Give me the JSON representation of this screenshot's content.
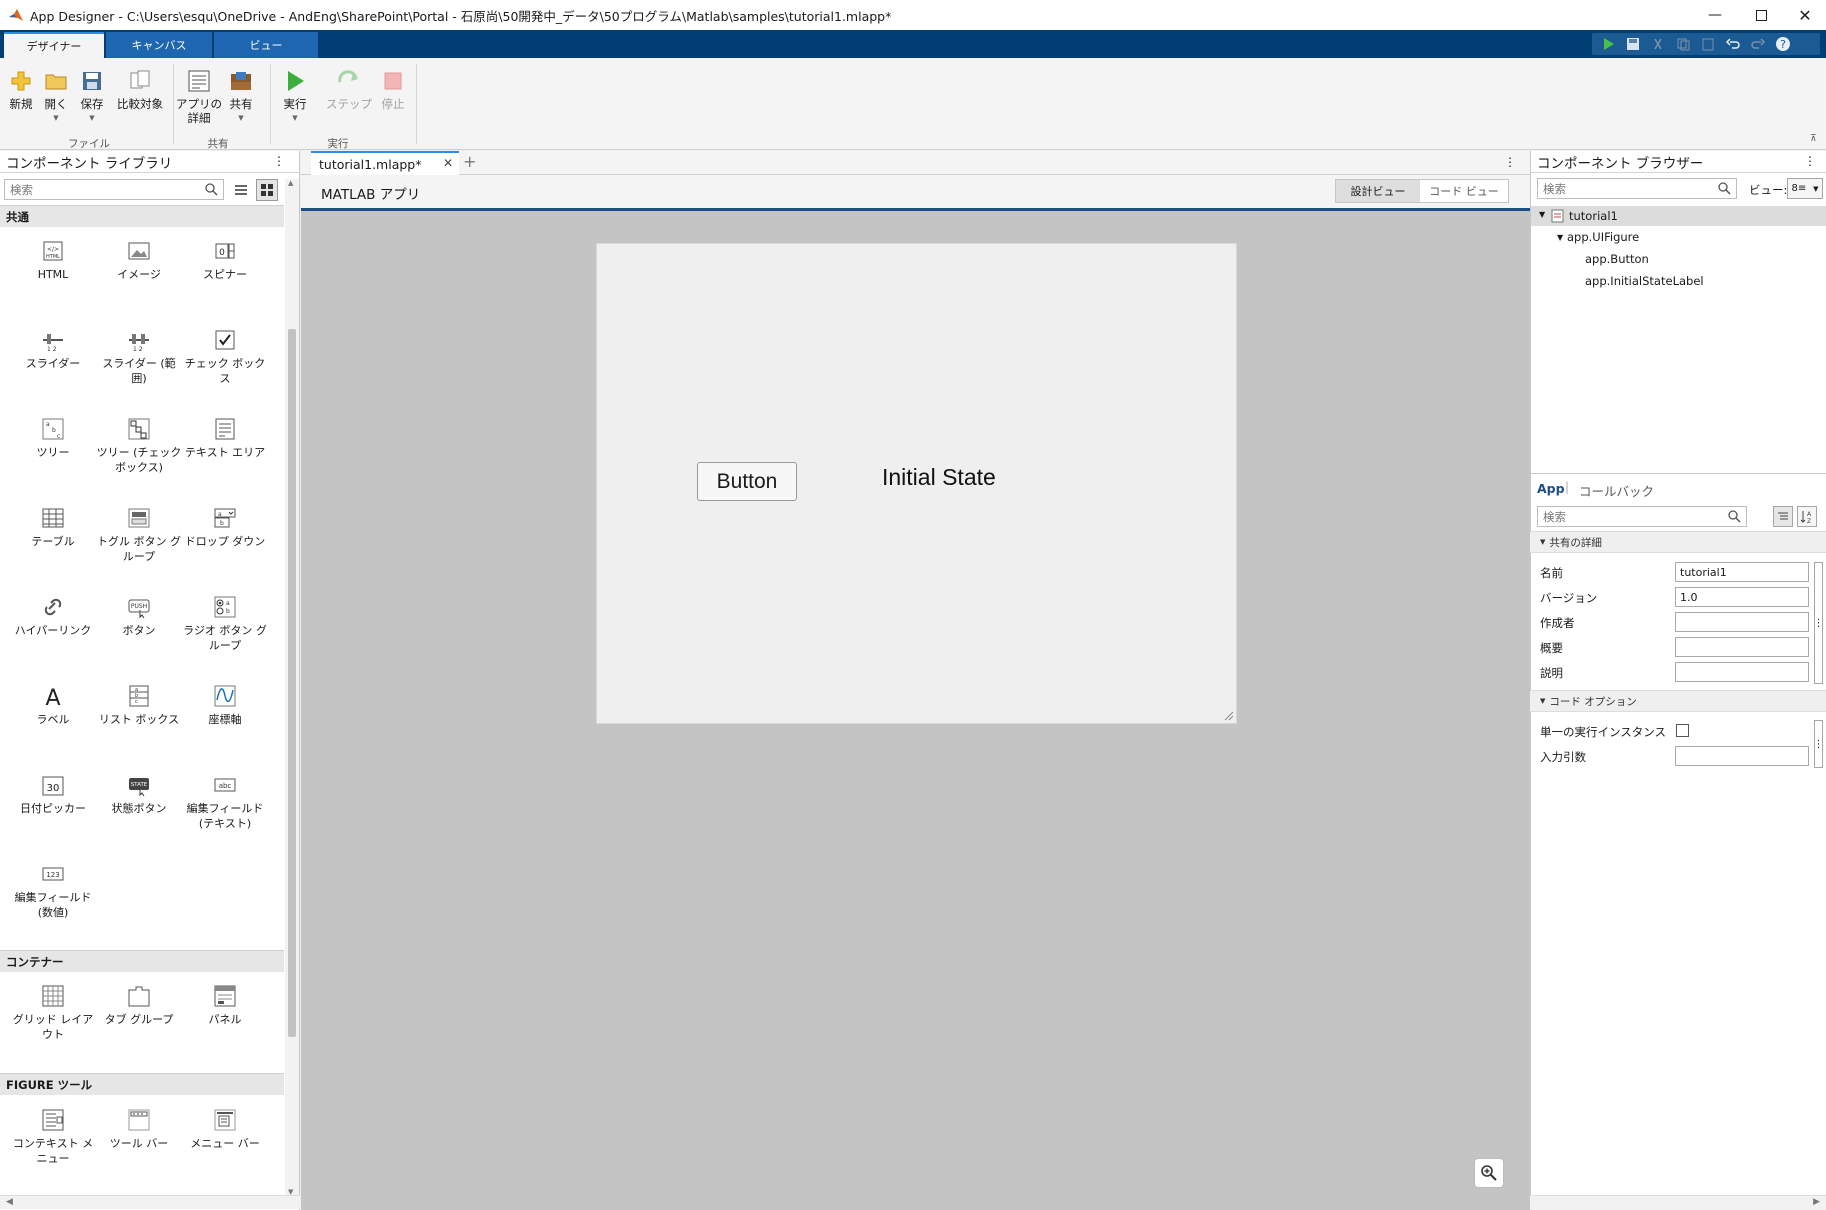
{
  "window": {
    "title": "App Designer - C:\\Users\\esqu\\OneDrive - AndEng\\SharePoint\\Portal - 石原尚\\50開発中_データ\\50プログラム\\Matlab\\samples\\tutorial1.mlapp*"
  },
  "ribbon_tabs": [
    {
      "label": "デザイナー"
    },
    {
      "label": "キャンバス"
    },
    {
      "label": "ビュー"
    }
  ],
  "ribbon": {
    "new": "新規",
    "open": "開く",
    "save": "保存",
    "compare": "比較対象",
    "app_details": "アプリの\n詳細",
    "share": "共有",
    "run": "実行",
    "step": "ステップ",
    "stop": "停止",
    "group_file": "ファイル",
    "group_share": "共有",
    "group_run": "実行"
  },
  "library": {
    "title": "コンポーネント ライブラリ",
    "search_placeholder": "検索",
    "section_common": "共通",
    "section_container": "コンテナー",
    "section_figure": "FIGURE ツール",
    "common": [
      {
        "label": "HTML",
        "icon": "html-icon"
      },
      {
        "label": "イメージ",
        "icon": "image-icon"
      },
      {
        "label": "スピナー",
        "icon": "spinner-icon"
      },
      {
        "label": "スライダー",
        "icon": "slider-icon"
      },
      {
        "label": "スライダー (範囲)",
        "icon": "range-slider-icon"
      },
      {
        "label": "チェック ボックス",
        "icon": "checkbox-icon"
      },
      {
        "label": "ツリー",
        "icon": "tree-icon"
      },
      {
        "label": "ツリー (チェック ボックス)",
        "icon": "checkbox-tree-icon"
      },
      {
        "label": "テキスト エリア",
        "icon": "text-area-icon"
      },
      {
        "label": "テーブル",
        "icon": "table-icon"
      },
      {
        "label": "トグル ボタン グループ",
        "icon": "toggle-button-group-icon"
      },
      {
        "label": "ドロップ ダウン",
        "icon": "dropdown-icon"
      },
      {
        "label": "ハイパーリンク",
        "icon": "hyperlink-icon"
      },
      {
        "label": "ボタン",
        "icon": "push-button-icon"
      },
      {
        "label": "ラジオ ボタン グループ",
        "icon": "radio-button-group-icon"
      },
      {
        "label": "ラベル",
        "icon": "label-icon"
      },
      {
        "label": "リスト ボックス",
        "icon": "list-box-icon"
      },
      {
        "label": "座標軸",
        "icon": "axes-icon"
      },
      {
        "label": "日付ピッカー",
        "icon": "date-picker-icon"
      },
      {
        "label": "状態ボタン",
        "icon": "state-button-icon"
      },
      {
        "label": "編集フィールド (テキスト)",
        "icon": "edit-field-text-icon"
      },
      {
        "label": "編集フィールド (数値)",
        "icon": "edit-field-numeric-icon"
      }
    ],
    "containers": [
      {
        "label": "グリッド レイアウト",
        "icon": "grid-layout-icon"
      },
      {
        "label": "タブ グループ",
        "icon": "tab-group-icon"
      },
      {
        "label": "パネル",
        "icon": "panel-icon"
      }
    ],
    "figure_tools": [
      {
        "label": "コンテキスト メニュー",
        "icon": "context-menu-icon"
      },
      {
        "label": "ツール バー",
        "icon": "toolbar-icon"
      },
      {
        "label": "メニュー バー",
        "icon": "menu-bar-icon"
      }
    ]
  },
  "editor": {
    "tab_label": "tutorial1.mlapp*",
    "header_title": "MATLAB アプリ",
    "design_view": "設計ビュー",
    "code_view": "コード ビュー",
    "ui_button": "Button",
    "ui_label": "Initial State"
  },
  "browser": {
    "title": "コンポーネント ブラウザー",
    "search_placeholder": "検索",
    "view_label": "ビュー:",
    "tree": [
      "tutorial1",
      "app.UIFigure",
      "app.Button",
      "app.InitialStateLabel"
    ]
  },
  "inspector": {
    "tab_app": "App",
    "tab_callback": "コールバック",
    "search_placeholder": "検索",
    "section_details": "共有の詳細",
    "section_code": "コード オプション",
    "name_label": "名前",
    "name_value": "tutorial1",
    "version_label": "バージョン",
    "version_value": "1.0",
    "author_label": "作成者",
    "summary_label": "概要",
    "description_label": "説明",
    "single_instance_label": "単一の実行インスタンス",
    "input_args_label": "入力引数"
  },
  "colors": {
    "ribbon_tab_bar": "#003e73",
    "canvas_bg": "#c4c4c4",
    "run_green": "#3cae3c"
  }
}
